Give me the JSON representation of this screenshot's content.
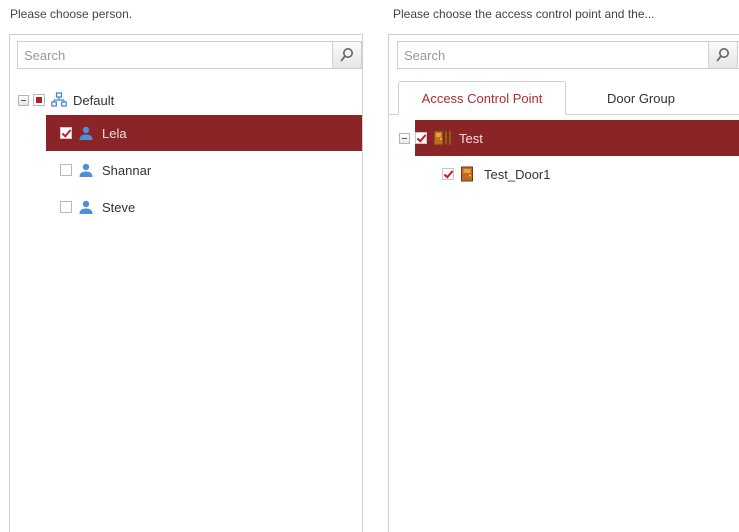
{
  "left": {
    "caption": "Please choose person.",
    "search": {
      "placeholder": "Search"
    },
    "tree": {
      "group": {
        "label": "Default",
        "state": "partial"
      },
      "items": [
        {
          "label": "Lela",
          "checked": true,
          "selected": true
        },
        {
          "label": "Shannar",
          "checked": false,
          "selected": false
        },
        {
          "label": "Steve",
          "checked": false,
          "selected": false
        }
      ]
    }
  },
  "right": {
    "caption": "Please choose the access control point and the...",
    "search": {
      "placeholder": "Search"
    },
    "tabs": [
      {
        "label": "Access Control Point",
        "active": true
      },
      {
        "label": "Door Group",
        "active": false
      }
    ],
    "tree": {
      "group": {
        "label": "Test",
        "checked": true,
        "selected": true
      },
      "items": [
        {
          "label": "Test_Door1",
          "checked": true
        }
      ]
    }
  },
  "colors": {
    "selection": "#8b2427",
    "accent": "#b22a2e",
    "check": "#c21c24"
  }
}
